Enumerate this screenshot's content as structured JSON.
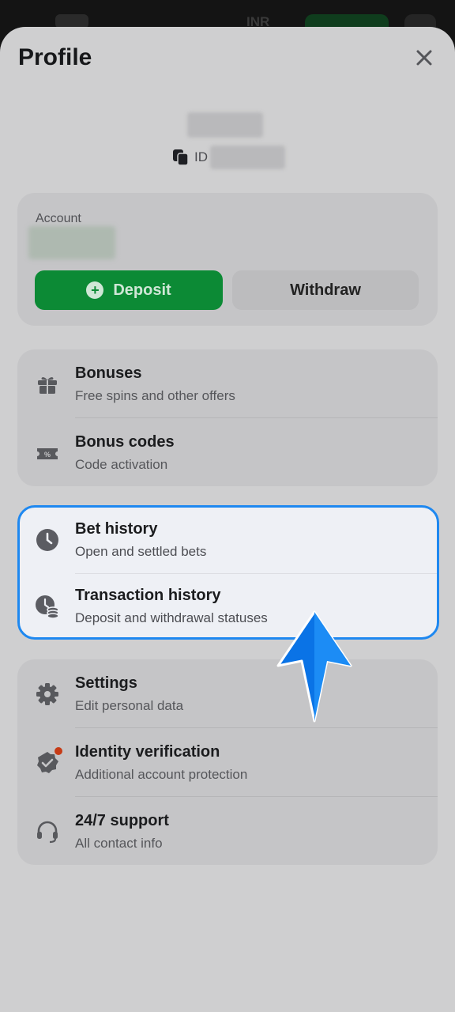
{
  "header": {
    "currency": "INR"
  },
  "profile": {
    "title": "Profile",
    "id_label": "ID"
  },
  "account": {
    "label": "Account",
    "deposit_label": "Deposit",
    "withdraw_label": "Withdraw"
  },
  "bonus_group": {
    "items": [
      {
        "title": "Bonuses",
        "subtitle": "Free spins and other offers",
        "icon": "gift-icon"
      },
      {
        "title": "Bonus codes",
        "subtitle": "Code activation",
        "icon": "ticket-icon"
      }
    ]
  },
  "history_group": {
    "items": [
      {
        "title": "Bet history",
        "subtitle": "Open and settled bets",
        "icon": "clock-icon"
      },
      {
        "title": "Transaction history",
        "subtitle": "Deposit and withdrawal statuses",
        "icon": "clock-coins-icon"
      }
    ]
  },
  "settings_group": {
    "items": [
      {
        "title": "Settings",
        "subtitle": "Edit personal data",
        "icon": "gear-icon"
      },
      {
        "title": "Identity verification",
        "subtitle": "Additional account protection",
        "icon": "verified-badge-icon"
      },
      {
        "title": "24/7 support",
        "subtitle": "All contact info",
        "icon": "headset-icon"
      }
    ]
  },
  "colors": {
    "accent_green": "#0c8a35",
    "highlight_blue": "#1e88f0",
    "notification_red": "#c63b16"
  }
}
